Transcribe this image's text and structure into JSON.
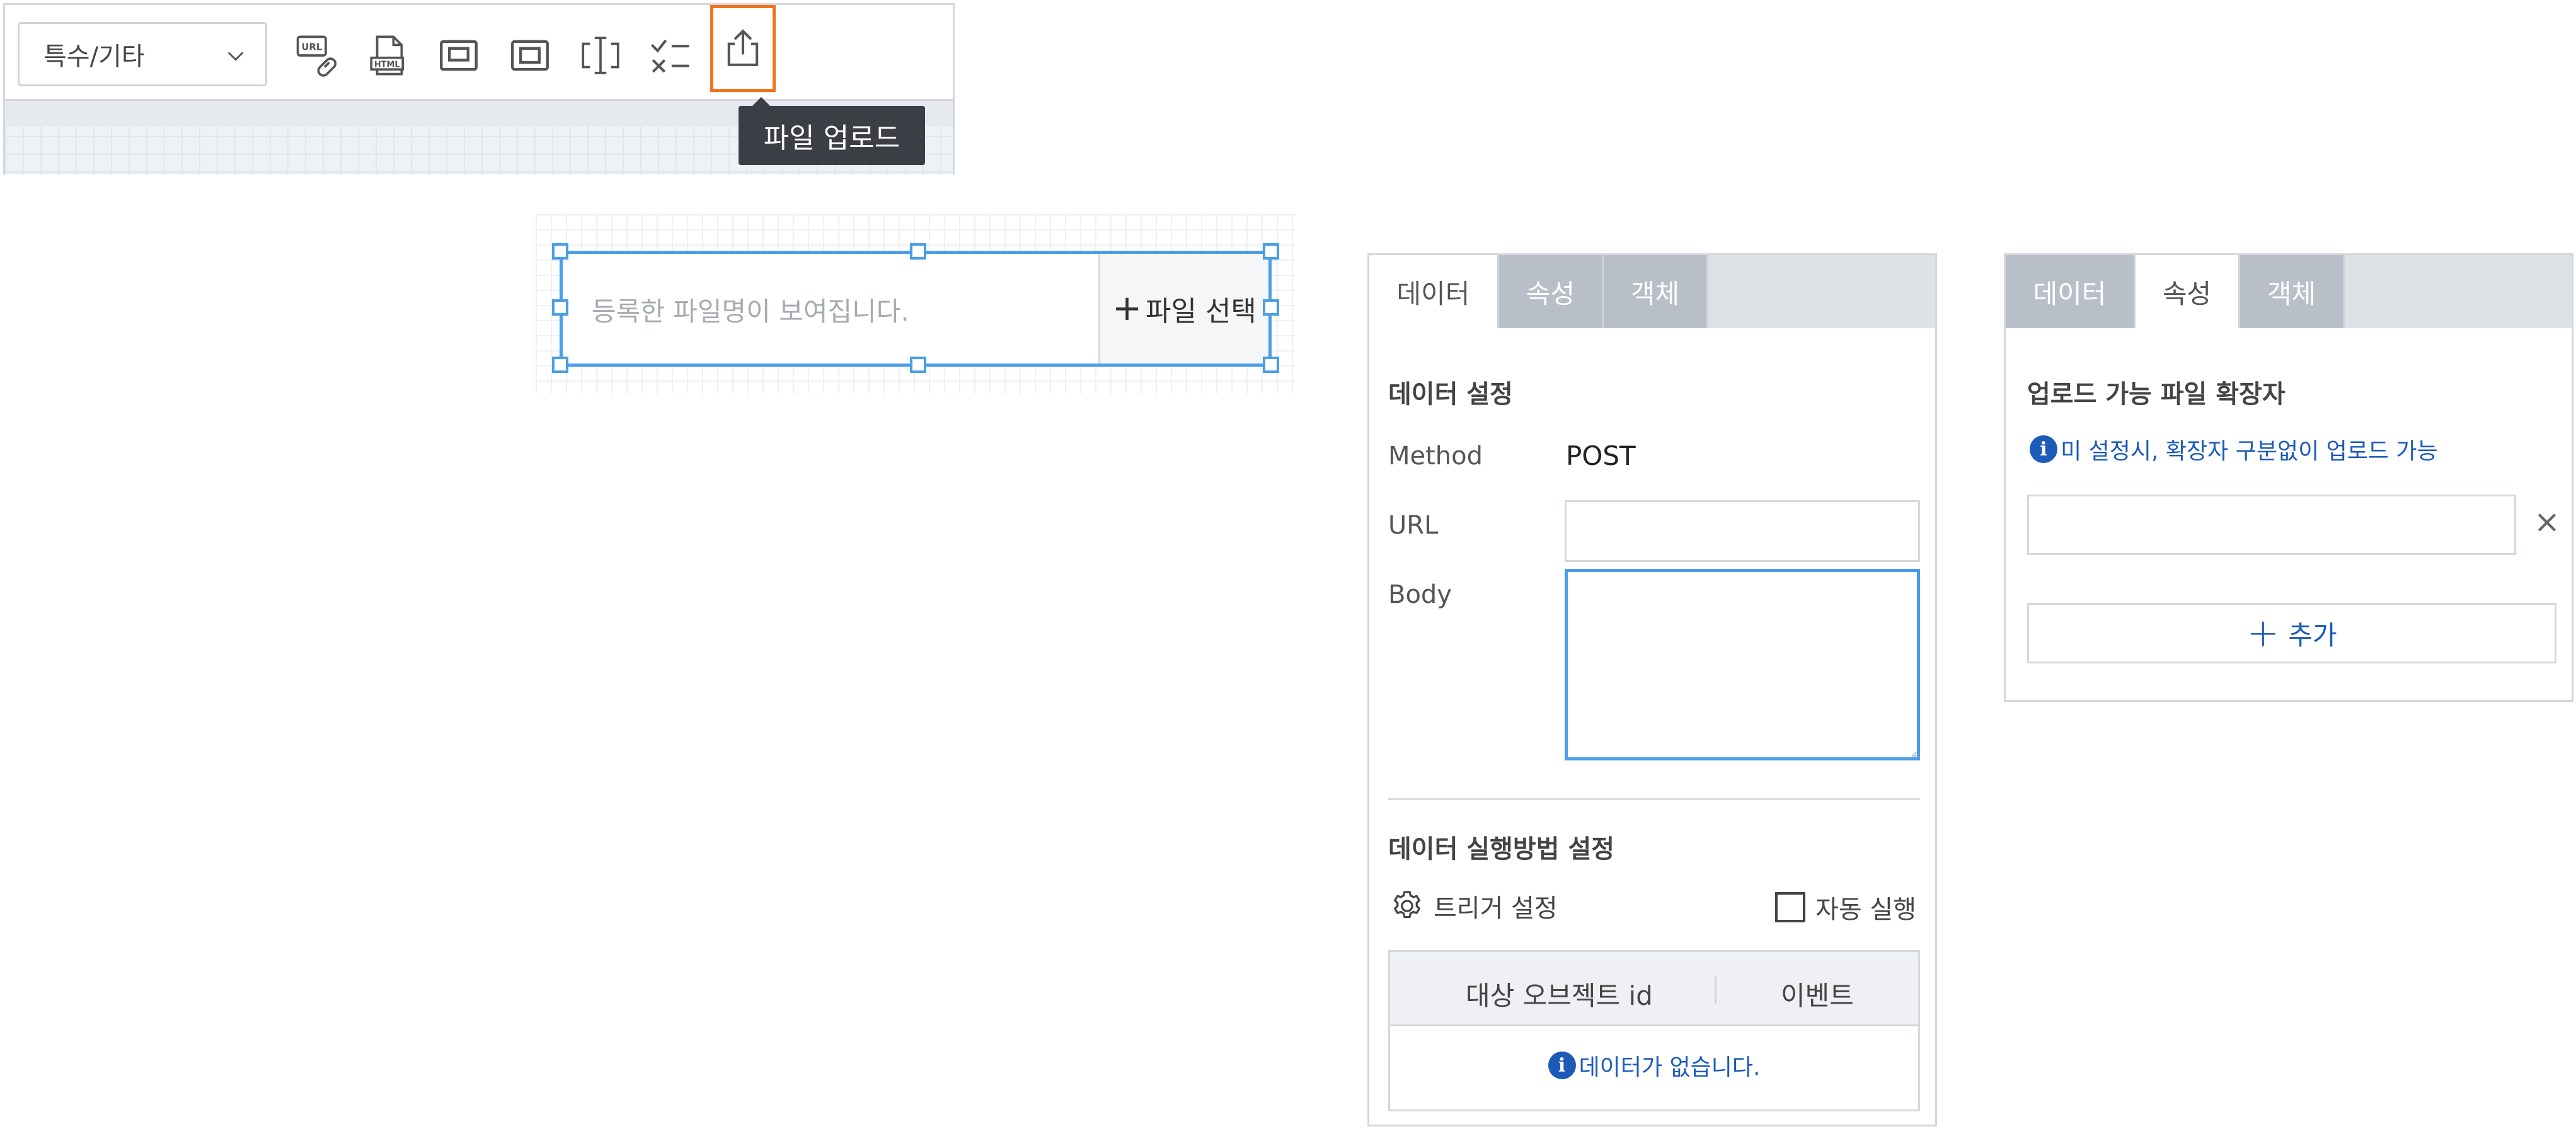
{
  "toolbar": {
    "category_select": "특수/기타",
    "tooltip": "파일 업로드",
    "icons": [
      "url-link-icon",
      "html-file-icon",
      "frame-icon",
      "inner-frame-icon",
      "text-cursor-icon",
      "checklist-icon",
      "upload-icon"
    ]
  },
  "file_component": {
    "placeholder": "등록한 파일명이 보여집니다.",
    "select_button": "파일 선택",
    "select_plus": "+"
  },
  "data_panel": {
    "tabs": [
      "데이터",
      "속성",
      "객체"
    ],
    "active_tab": 0,
    "section_title": "데이터 설정",
    "method_label": "Method",
    "method_value": "POST",
    "url_label": "URL",
    "url_value": "",
    "body_label": "Body",
    "body_value": "",
    "exec_title": "데이터 실행방법 설정",
    "trigger_label": "트리거 설정",
    "auto_run_label": "자동 실행",
    "auto_run_checked": false,
    "table_headers": [
      "대상 오브젝트 id",
      "이벤트"
    ],
    "empty_message": "데이터가 없습니다.",
    "info_glyph": "i"
  },
  "attr_panel": {
    "tabs": [
      "데이터",
      "속성",
      "객체"
    ],
    "active_tab": 1,
    "section_title": "업로드 가능 파일 확장자",
    "info_message": "미 설정시, 확장자 구분없이 업로드 가능",
    "extension_value": "",
    "remove_glyph": "×",
    "add_label": "추가",
    "add_plus": "+",
    "info_glyph": "i"
  },
  "colors": {
    "accent_blue": "#4a9ee8",
    "info_blue": "#1d5bb8",
    "active_orange": "#f0741d",
    "tab_inactive": "#b9bfc8",
    "tooltip_bg": "#3b3e44"
  }
}
